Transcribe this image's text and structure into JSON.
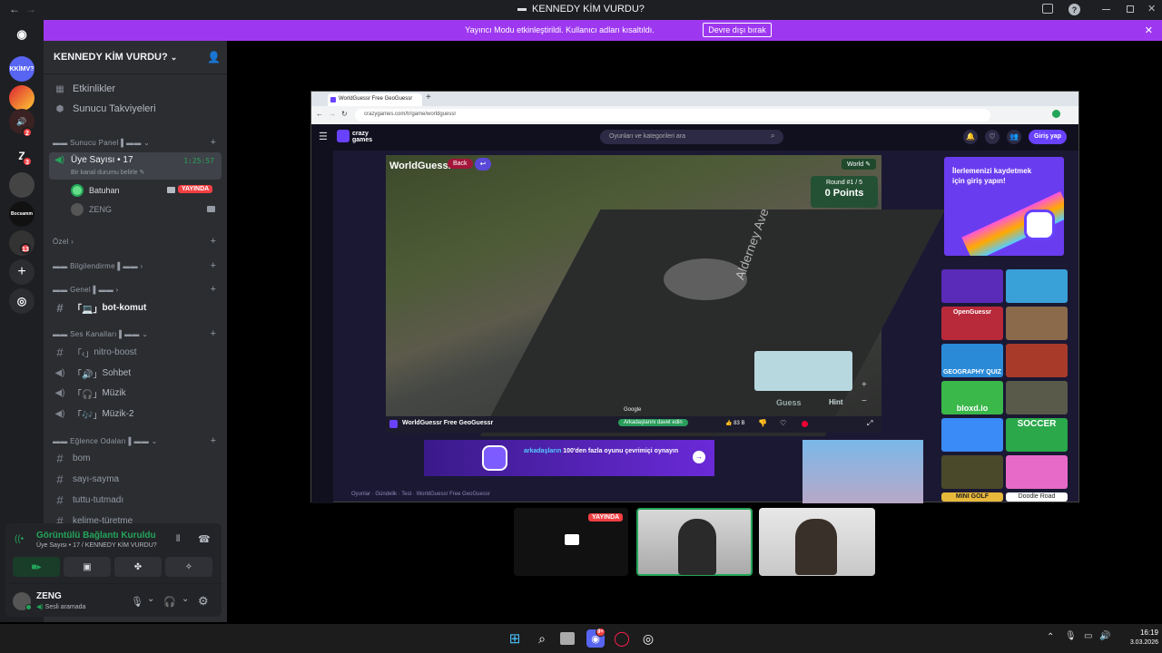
{
  "window": {
    "title": "KENNEDY KİM VURDU?"
  },
  "banner": {
    "message": "Yayıncı Modu etkinleştirildi. Kullanıcı adları kısaltıldı.",
    "button": "Devre dışı bırak"
  },
  "servers": [
    {
      "label": "KKİMV?",
      "badge": ""
    },
    {
      "label": "",
      "badge": ""
    },
    {
      "label": "",
      "badge": "2"
    },
    {
      "label": "Z",
      "badge": "3"
    },
    {
      "label": "",
      "badge": ""
    },
    {
      "label": "Bocsamm",
      "badge": ""
    },
    {
      "label": "",
      "badge": "13"
    }
  ],
  "sidebar": {
    "server_name": "KENNEDY KİM VURDU?",
    "top_items": [
      "Etkinlikler",
      "Sunucu Takviyeleri"
    ],
    "cat_panel": "Sunucu Panel",
    "member_channel": "Üye Sayısı • 17",
    "member_status": "Bir kanal durumu belirle",
    "member_timer": "1:25:57",
    "users": [
      {
        "name": "Batuhan",
        "live": "YAYINDA"
      },
      {
        "name": "ZENG",
        "live": ""
      }
    ],
    "cat_ozel": "Özel",
    "cat_bilgi": "Bilgilendirme",
    "cat_genel": "Genel",
    "ch_bot": "bot-komut",
    "cat_ses": "Ses Kanalları",
    "voice_channels": [
      "nitro-boost",
      "Sohbet",
      "Müzik",
      "Müzik-2"
    ],
    "cat_eglence": "Eğlence Odaları",
    "fun_channels": [
      "bom",
      "sayı-sayma",
      "tuttu-tutmadı",
      "kelime-türetme"
    ]
  },
  "voice": {
    "status": "Görüntülü Bağlantı Kuruldu",
    "sub": "Üye Sayısı • 17 / KENNEDY KİM VURDU?"
  },
  "user": {
    "name": "ZENG",
    "status": "Sesli aramada"
  },
  "browser": {
    "tab_title": "WorldGuessr Free GeoGuessr",
    "url": "crazygames.com/tr/game/worldguessr",
    "search_placeholder": "Oyunları ve kategorileri ara",
    "login": "Giriş yap",
    "game_logo": "WorldGuessr",
    "back": "Back",
    "world": "World",
    "round": "Round #1 / 5",
    "points": "0 Points",
    "street": "Alderney Ave",
    "guess": "Guess",
    "hint": "Hint",
    "google": "Google",
    "game_title": "WorldGuessr Free GeoGuessr",
    "invite": "Arkadaşlarını davet edin",
    "likes": "83 B",
    "promo_title": "İlerlemenizi kaydetmek için giriş yapın!",
    "ad_text_a": "arkadaşların",
    "ad_text_b": " 100'den fazla oyunu çevrimiçi oynayın",
    "breadcrumb": "Oyunlar · Gündelik · Test · WorldGuessr Free GeoGuessr",
    "thumbs": [
      "",
      "",
      "OpenGuessr",
      "",
      "GEOGRAPHY QUIZ",
      "",
      "bloxd.io",
      "",
      "",
      "SOCCER",
      "",
      "",
      "MINI GOLF",
      "Doodle Road"
    ]
  },
  "live_badge": "YAYINDA",
  "taskbar": {
    "time": "16:19",
    "date": "3.03.2026",
    "opera_badge": "9+"
  },
  "colors": {
    "accent": "#9e38f0",
    "live": "#f23f43",
    "green": "#23a559"
  }
}
